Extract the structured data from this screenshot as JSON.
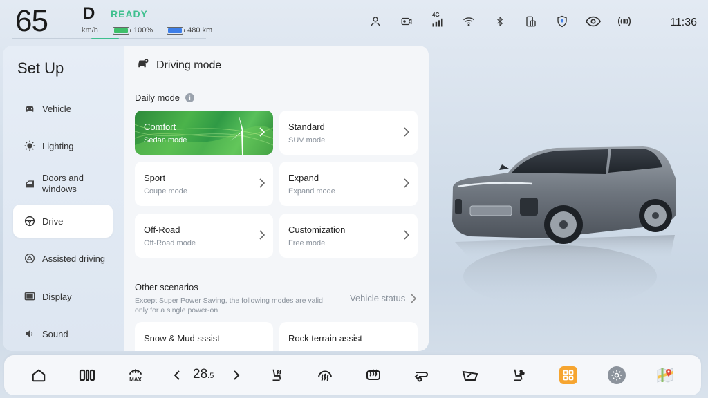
{
  "status": {
    "speed": "65",
    "speed_unit": "km/h",
    "gear": "D",
    "ready": "READY",
    "battery_percent": "100%",
    "range": "480 km",
    "clock": "11:36",
    "network": "4G",
    "icons": [
      "user-icon",
      "dashcam-icon",
      "signal-4g-icon",
      "wifi-icon",
      "bluetooth-icon",
      "phone-card-icon",
      "shield-icon",
      "eye-icon",
      "radio-icon"
    ]
  },
  "sidebar": {
    "title": "Set Up",
    "items": [
      {
        "label": "Vehicle",
        "icon": "car-icon"
      },
      {
        "label": "Lighting",
        "icon": "sun-icon"
      },
      {
        "label": "Doors and\nwindows",
        "icon": "door-icon"
      },
      {
        "label": "Drive",
        "icon": "steering-wheel-icon"
      },
      {
        "label": "Assisted driving",
        "icon": "assist-icon"
      },
      {
        "label": "Display",
        "icon": "display-icon"
      },
      {
        "label": "Sound",
        "icon": "speaker-icon"
      }
    ],
    "active_index": 3
  },
  "content": {
    "title": "Driving mode",
    "daily_label": "Daily mode",
    "modes": [
      {
        "title": "Comfort",
        "subtitle": "Sedan mode"
      },
      {
        "title": "Standard",
        "subtitle": "SUV mode"
      },
      {
        "title": "Sport",
        "subtitle": "Coupe mode"
      },
      {
        "title": "Expand",
        "subtitle": "Expand mode"
      },
      {
        "title": "Off-Road",
        "subtitle": "Off-Road mode"
      },
      {
        "title": "Customization",
        "subtitle": "Free mode"
      }
    ],
    "other_title": "Other scenarios",
    "other_desc": "Except Super Power Saving, the following modes are valid only for a single power-on",
    "vehicle_status": "Vehicle status",
    "scenarios": [
      {
        "title": "Snow & Mud sssist"
      },
      {
        "title": "Rock terrain assist"
      }
    ]
  },
  "dock": {
    "temperature_main": "28",
    "temperature_decimal": ".5",
    "max_label": "MAX"
  },
  "colors": {
    "ready": "#3fc08f",
    "comfort_green": "#3aa545",
    "apps_orange": "#f6a530"
  }
}
